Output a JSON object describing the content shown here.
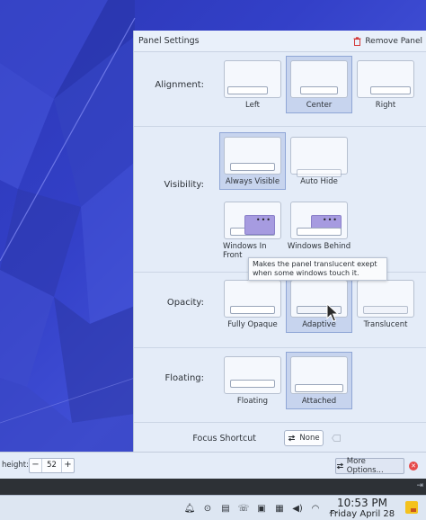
{
  "settings": {
    "title": "Panel Settings",
    "remove_label": "Remove Panel",
    "alignment": {
      "label": "Alignment:",
      "options": [
        "Left",
        "Center",
        "Right"
      ],
      "selected": "Center"
    },
    "visibility": {
      "label": "Visibility:",
      "options": [
        "Always Visible",
        "Auto Hide",
        "Windows In Front",
        "Windows Behind"
      ],
      "selected": "Always Visible"
    },
    "tooltip": "Makes the panel translucent exept when some windows touch it.",
    "opacity": {
      "label": "Opacity:",
      "options": [
        "Fully Opaque",
        "Adaptive",
        "Translucent"
      ],
      "selected": "Adaptive"
    },
    "floating": {
      "label": "Floating:",
      "options": [
        "Floating",
        "Attached"
      ],
      "selected": "Attached"
    },
    "focus": {
      "label": "Focus Shortcut",
      "value": "None"
    }
  },
  "toolbar": {
    "height_label": "height:",
    "height_value": "52",
    "minus": "−",
    "plus": "+",
    "more_label": "More Options..."
  },
  "taskbar": {
    "time": "10:53 PM",
    "date": "Friday April 28",
    "tray_icons": [
      "notifications-icon",
      "update-icon",
      "clipboard-icon",
      "kde-connect-icon",
      "disk-icon",
      "display-icon",
      "volume-icon",
      "wifi-icon",
      "chevron-up-icon"
    ]
  },
  "colors": {
    "wallpaper": "#3340c8",
    "accent_selected": "#c7d4ee",
    "window_bg": "#e4ecf8",
    "close_red": "#e64a4a"
  }
}
